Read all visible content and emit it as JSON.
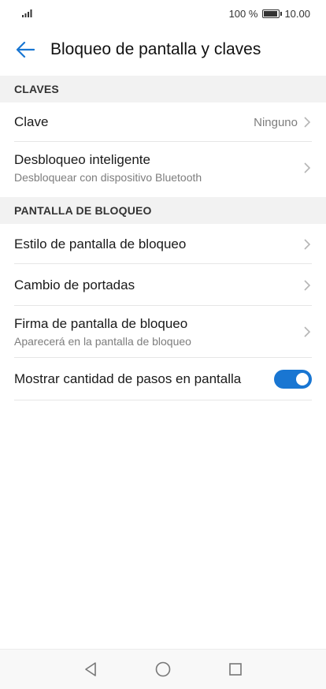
{
  "status_bar": {
    "signal_icon": "signal-icon",
    "battery_text": "100 %",
    "time": "10.00",
    "battery_level": 1.0
  },
  "header": {
    "back_icon": "arrow-left-icon",
    "title": "Bloqueo de pantalla y claves"
  },
  "sections": {
    "claves": {
      "header": "CLAVES",
      "clave": {
        "title": "Clave",
        "value": "Ninguno"
      },
      "desbloqueo": {
        "title": "Desbloqueo inteligente",
        "subtitle": "Desbloquear con dispositivo Bluetooth"
      }
    },
    "pantalla": {
      "header": "PANTALLA DE BLOQUEO",
      "estilo": {
        "title": "Estilo de pantalla de bloqueo"
      },
      "portadas": {
        "title": "Cambio de portadas"
      },
      "firma": {
        "title": "Firma de pantalla de bloqueo",
        "subtitle": "Aparecerá en la pantalla de bloqueo"
      },
      "pasos": {
        "title": "Mostrar cantidad de pasos en pantalla",
        "enabled": true
      }
    }
  },
  "colors": {
    "accent": "#1976d2",
    "section_bg": "#f2f2f2"
  },
  "navbar": {
    "back_icon": "triangle-back-icon",
    "home_icon": "circle-home-icon",
    "recents_icon": "square-recents-icon"
  }
}
